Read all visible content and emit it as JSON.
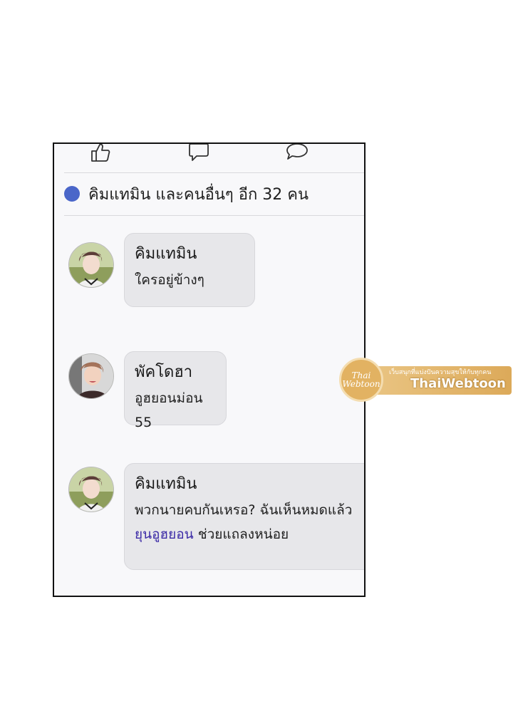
{
  "likes": {
    "text": "คิมแทมิน และคนอื่นๆ อีก 32 คน",
    "dot_color": "#4a66c9"
  },
  "actions": [
    {
      "icon": "thumbs-up-icon"
    },
    {
      "icon": "comment-icon"
    },
    {
      "icon": "share-icon"
    }
  ],
  "comments": [
    {
      "name": "คิมแทมิน",
      "text": "ใครอยู่ข้างๆ",
      "mention": ""
    },
    {
      "name": "พัคโดฮา",
      "text": "อูฮยอนม่อน 55",
      "mention": ""
    },
    {
      "name": "คิมแทมิน",
      "text": "พวกนายคบกันเหรอ? ฉันเห็นหมดแล้ว",
      "mention": "ยุนอูฮยอน",
      "text2": " ช่วยแถลงหน่อย"
    }
  ],
  "watermark": {
    "logo_line1": "Thai",
    "logo_line2": "Webtoon",
    "tagline": "เว็บสนุกที่แบ่งปันความสุขให้กับทุกคน",
    "brand": "ThaiWebtoon"
  }
}
